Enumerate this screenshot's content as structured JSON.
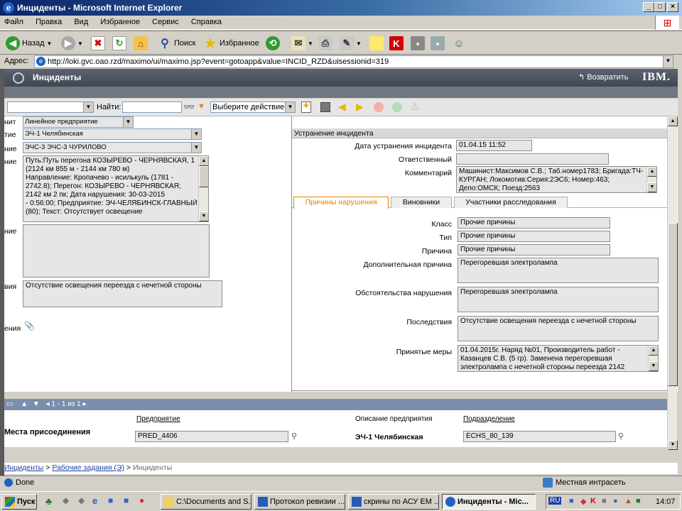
{
  "window": {
    "title": "Инциденты - Microsoft Internet Explorer"
  },
  "menu": [
    "Файл",
    "Правка",
    "Вид",
    "Избранное",
    "Сервис",
    "Справка"
  ],
  "toolbar": {
    "back_label": "Назад",
    "search_label": "Поиск",
    "favorites_label": "Избранное"
  },
  "address": {
    "label": "Адрес:",
    "url": "http://loki.gvc.oao.rzd/maximo/ui/maximo.jsp?event=gotoapp&value=INCID_RZD&uisessionid=319"
  },
  "app": {
    "title": "Инциденты",
    "return_label": "Возвратить",
    "brand": "IBM."
  },
  "app_toolbar": {
    "find_label": "Найти:",
    "action_select": "Выберите действие"
  },
  "left_panel": {
    "fields": [
      {
        "label": "нит",
        "value": "Линейное предприятие"
      },
      {
        "label": "тие",
        "value": "ЭЧ-1 Челябинская"
      },
      {
        "label": "ние",
        "value": "ЭЧС-3 ЭЧС-3 ЧУРИЛОВО"
      }
    ],
    "place_label": "ние",
    "place_lines": [
      "Путь:Путь перегона КОЗЫРЕВО - ЧЕРНЯВСКАЯ, 1",
      "(2124 км 855 м - 2144 км 780 м)",
      "Направление: Кропачево - исилькуль (1781 -",
      "2742.8); Перегон: КОЗЫРЕВО - ЧЕРНЯВСКАЯ;",
      "2142 км 2 пк; Дата нарушения: 30-03-2015",
      "- 0:56:00; Предприятие: ЭЧ-ЧЕЛЯБИНСК-ГЛАВНЫЙ",
      "(80); Текст: Отсутствует освещение"
    ],
    "empty_label": "ние",
    "violation_label": "вия",
    "violation_text": "Отсутствие освещения переезда с нечетной стороны",
    "attach_label": "ения"
  },
  "right_panel": {
    "section_title": "Устранение инцидента",
    "fix_date_label": "Дата устранения инцидента",
    "fix_date": "01.04.15 11:52",
    "responsible_label": "Ответственный",
    "responsible": "",
    "comment_label": "Комментарий",
    "comment_lines": [
      "Машинист:Максимов С.В.; Таб.номер1783; Бригада:ТЧ-",
      "КУРГАН; Локомотив:Серия:2ЭС6; Номер:463;",
      "Депо:ОМСК; Поезд:2563"
    ],
    "tabs": [
      "Причины нарушения",
      "Виновники",
      "Участники расследования"
    ],
    "class_label": "Класс",
    "class_value": "Прочие причины",
    "type_label": "Тип",
    "type_value": "Прочие причины",
    "reason_label": "Причина",
    "reason_value": "Прочие причины",
    "add_reason_label": "Дополнительная причина",
    "add_reason_value": "Перегоревшая электролампа",
    "circ_label": "Обстоятельства нарушения",
    "circ_value": "Перегоревшая электролампа",
    "conseq_label": "Последствия",
    "conseq_value": "Отсутствие освещения переезда с нечетной стороны",
    "measures_label": "Принятые меры",
    "measures_lines": [
      "01.04.2015г. Наряд №01, Производитель работ -",
      "Казанцев С.В. (5 гр). Заменена перегоревшая",
      "электролампа с нечетной стороны переезда 2142"
    ]
  },
  "bottom": {
    "pager": "1 - 1 из 1",
    "section_title": "Места присоединения",
    "col1": "Предприятие",
    "col1_value": "PRED_4406",
    "col2": "Описание предприятия",
    "col2_value": "ЭЧ-1 Челябинская",
    "col3": "Подразделение",
    "col3_value": "ECHS_80_139"
  },
  "breadcrumb": {
    "a": "Инциденты",
    "sep1": " > ",
    "b": "Рабочие задания (Э)",
    "sep2": " > ",
    "c": "Инциденты"
  },
  "status": {
    "done": "Done",
    "zone": "Местная интрасеть"
  },
  "taskbar": {
    "start": "Пуск",
    "tasks": [
      "C:\\Documents and S...",
      "Протокол ревизии ...",
      "скрины по АСУ ЕМ ...",
      "Инциденты - Mic..."
    ],
    "lang": "RU",
    "time": "14:07"
  }
}
